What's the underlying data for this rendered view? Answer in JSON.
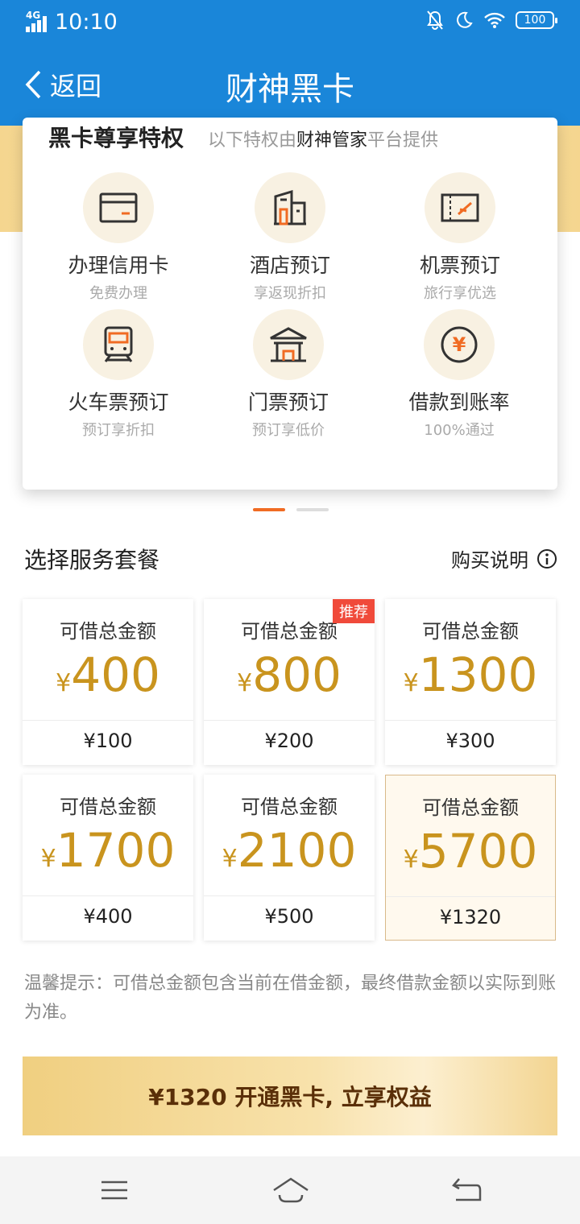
{
  "status_bar": {
    "network": "4G",
    "time": "10:10",
    "battery": "100"
  },
  "header": {
    "back_label": "返回",
    "title": "财神黑卡"
  },
  "privileges": {
    "title": "黑卡尊享特权",
    "subtitle_prefix": "以下特权由",
    "subtitle_highlight": "财神管家",
    "subtitle_suffix": "平台提供",
    "items": [
      {
        "icon": "credit-card-icon",
        "name": "办理信用卡",
        "desc": "免费办理"
      },
      {
        "icon": "hotel-icon",
        "name": "酒店预订",
        "desc": "享返现折扣"
      },
      {
        "icon": "flight-ticket-icon",
        "name": "机票预订",
        "desc": "旅行享优选"
      },
      {
        "icon": "train-icon",
        "name": "火车票预订",
        "desc": "预订享折扣"
      },
      {
        "icon": "pavilion-icon",
        "name": "门票预订",
        "desc": "预订享低价"
      },
      {
        "icon": "yuan-coin-icon",
        "name": "借款到账率",
        "desc": "100%通过"
      }
    ]
  },
  "packages_section": {
    "title": "选择服务套餐",
    "note": "购买说明"
  },
  "packages": [
    {
      "label": "可借总金额",
      "currency": "¥",
      "amount": "400",
      "fee": "¥100",
      "badge": "",
      "selected": false
    },
    {
      "label": "可借总金额",
      "currency": "¥",
      "amount": "800",
      "fee": "¥200",
      "badge": "推荐",
      "selected": false
    },
    {
      "label": "可借总金额",
      "currency": "¥",
      "amount": "1300",
      "fee": "¥300",
      "badge": "",
      "selected": false
    },
    {
      "label": "可借总金额",
      "currency": "¥",
      "amount": "1700",
      "fee": "¥400",
      "badge": "",
      "selected": false
    },
    {
      "label": "可借总金额",
      "currency": "¥",
      "amount": "2100",
      "fee": "¥500",
      "badge": "",
      "selected": false
    },
    {
      "label": "可借总金额",
      "currency": "¥",
      "amount": "5700",
      "fee": "¥1320",
      "badge": "",
      "selected": true
    }
  ],
  "tip": "温馨提示：可借总金额包含当前在借金额，最终借款金额以实际到账为准。",
  "cta": {
    "label": "¥1320 开通黑卡, 立享权益"
  },
  "colors": {
    "header_bg": "#1a86d9",
    "accent_gold": "#c9941e",
    "badge_red": "#f04a3a",
    "indicator_orange": "#f06b23"
  }
}
